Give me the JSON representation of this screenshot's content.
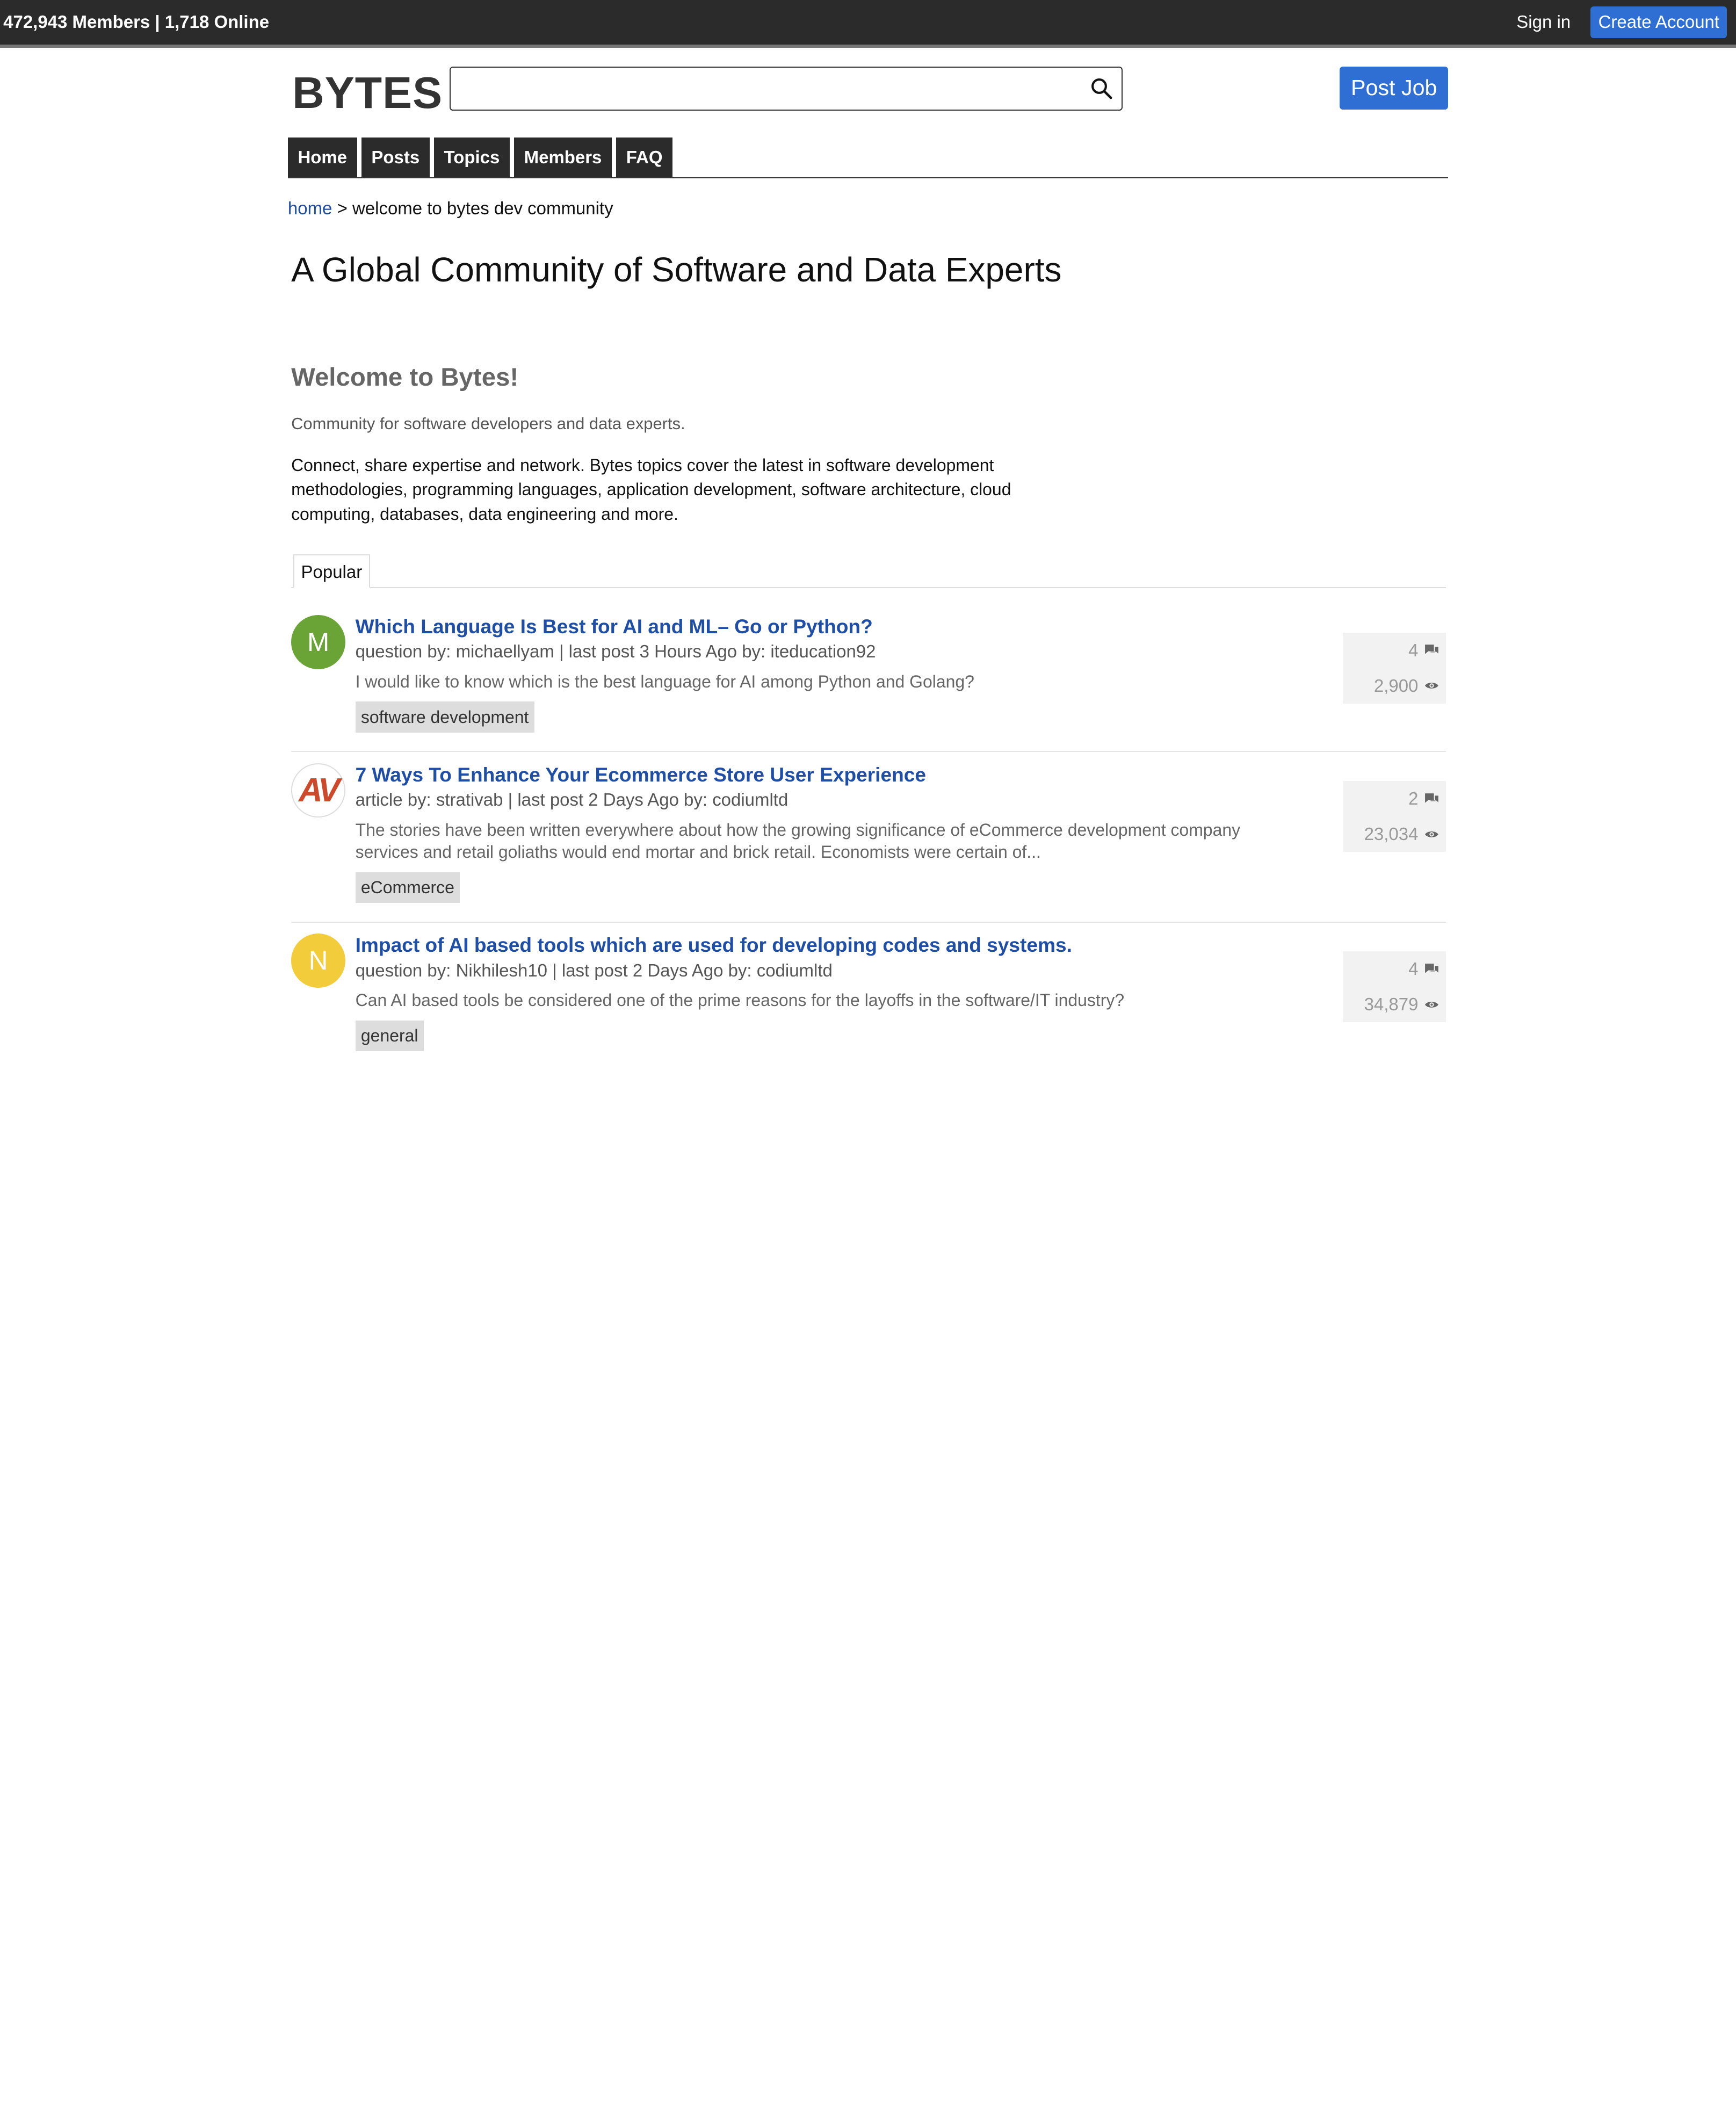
{
  "topbar": {
    "stats": "472,943 Members | 1,718 Online",
    "signin": "Sign in",
    "create_account": "Create Account"
  },
  "header": {
    "logo": "BYTES",
    "search_value": "",
    "post_job": "Post Job"
  },
  "nav": {
    "tabs": [
      {
        "label": "Home"
      },
      {
        "label": "Posts"
      },
      {
        "label": "Topics"
      },
      {
        "label": "Members"
      },
      {
        "label": "FAQ"
      }
    ]
  },
  "breadcrumb": {
    "home": "home",
    "separator": ">",
    "current": "welcome to bytes dev community"
  },
  "page": {
    "title": "A Global Community of Software and Data Experts",
    "welcome_title": "Welcome to Bytes!",
    "welcome_sub": "Community for software developers and data experts.",
    "welcome_body": "Connect, share expertise and network. Bytes topics cover the latest in software development methodologies, programming languages, application development, software architecture, cloud computing, databases, data engineering and more."
  },
  "tabs": {
    "popular": "Popular"
  },
  "posts": [
    {
      "avatar_letter": "M",
      "avatar_color": "#6aa436",
      "title": "Which Language Is Best for AI and ML– Go or Python?",
      "meta": "question by: michaellyam | last post 3 Hours Ago by: iteducation92",
      "excerpt": "I would like to know which is the best language for AI among Python and Golang?",
      "tag": "software development",
      "replies": "4",
      "views": "2,900"
    },
    {
      "avatar_letter": "AV",
      "avatar_color": "#cc4a2b",
      "title": "7 Ways To Enhance Your Ecommerce Store User Experience",
      "meta": "article by: strativab | last post 2 Days Ago by: codiumltd",
      "excerpt": "The stories have been written everywhere about how the growing significance of eCommerce development company services and retail goliaths would end mortar and brick retail. Economists were certain of...",
      "tag": "eCommerce",
      "replies": "2",
      "views": "23,034"
    },
    {
      "avatar_letter": "N",
      "avatar_color": "#f2cc3a",
      "title": "Impact of AI based tools which are used for developing codes and systems.",
      "meta": "question by: Nikhilesh10 | last post 2 Days Ago by: codiumltd",
      "excerpt": "Can AI based tools be considered one of the prime reasons for the layoffs in the software/IT industry?",
      "tag": "general",
      "replies": "4",
      "views": "34,879"
    }
  ]
}
